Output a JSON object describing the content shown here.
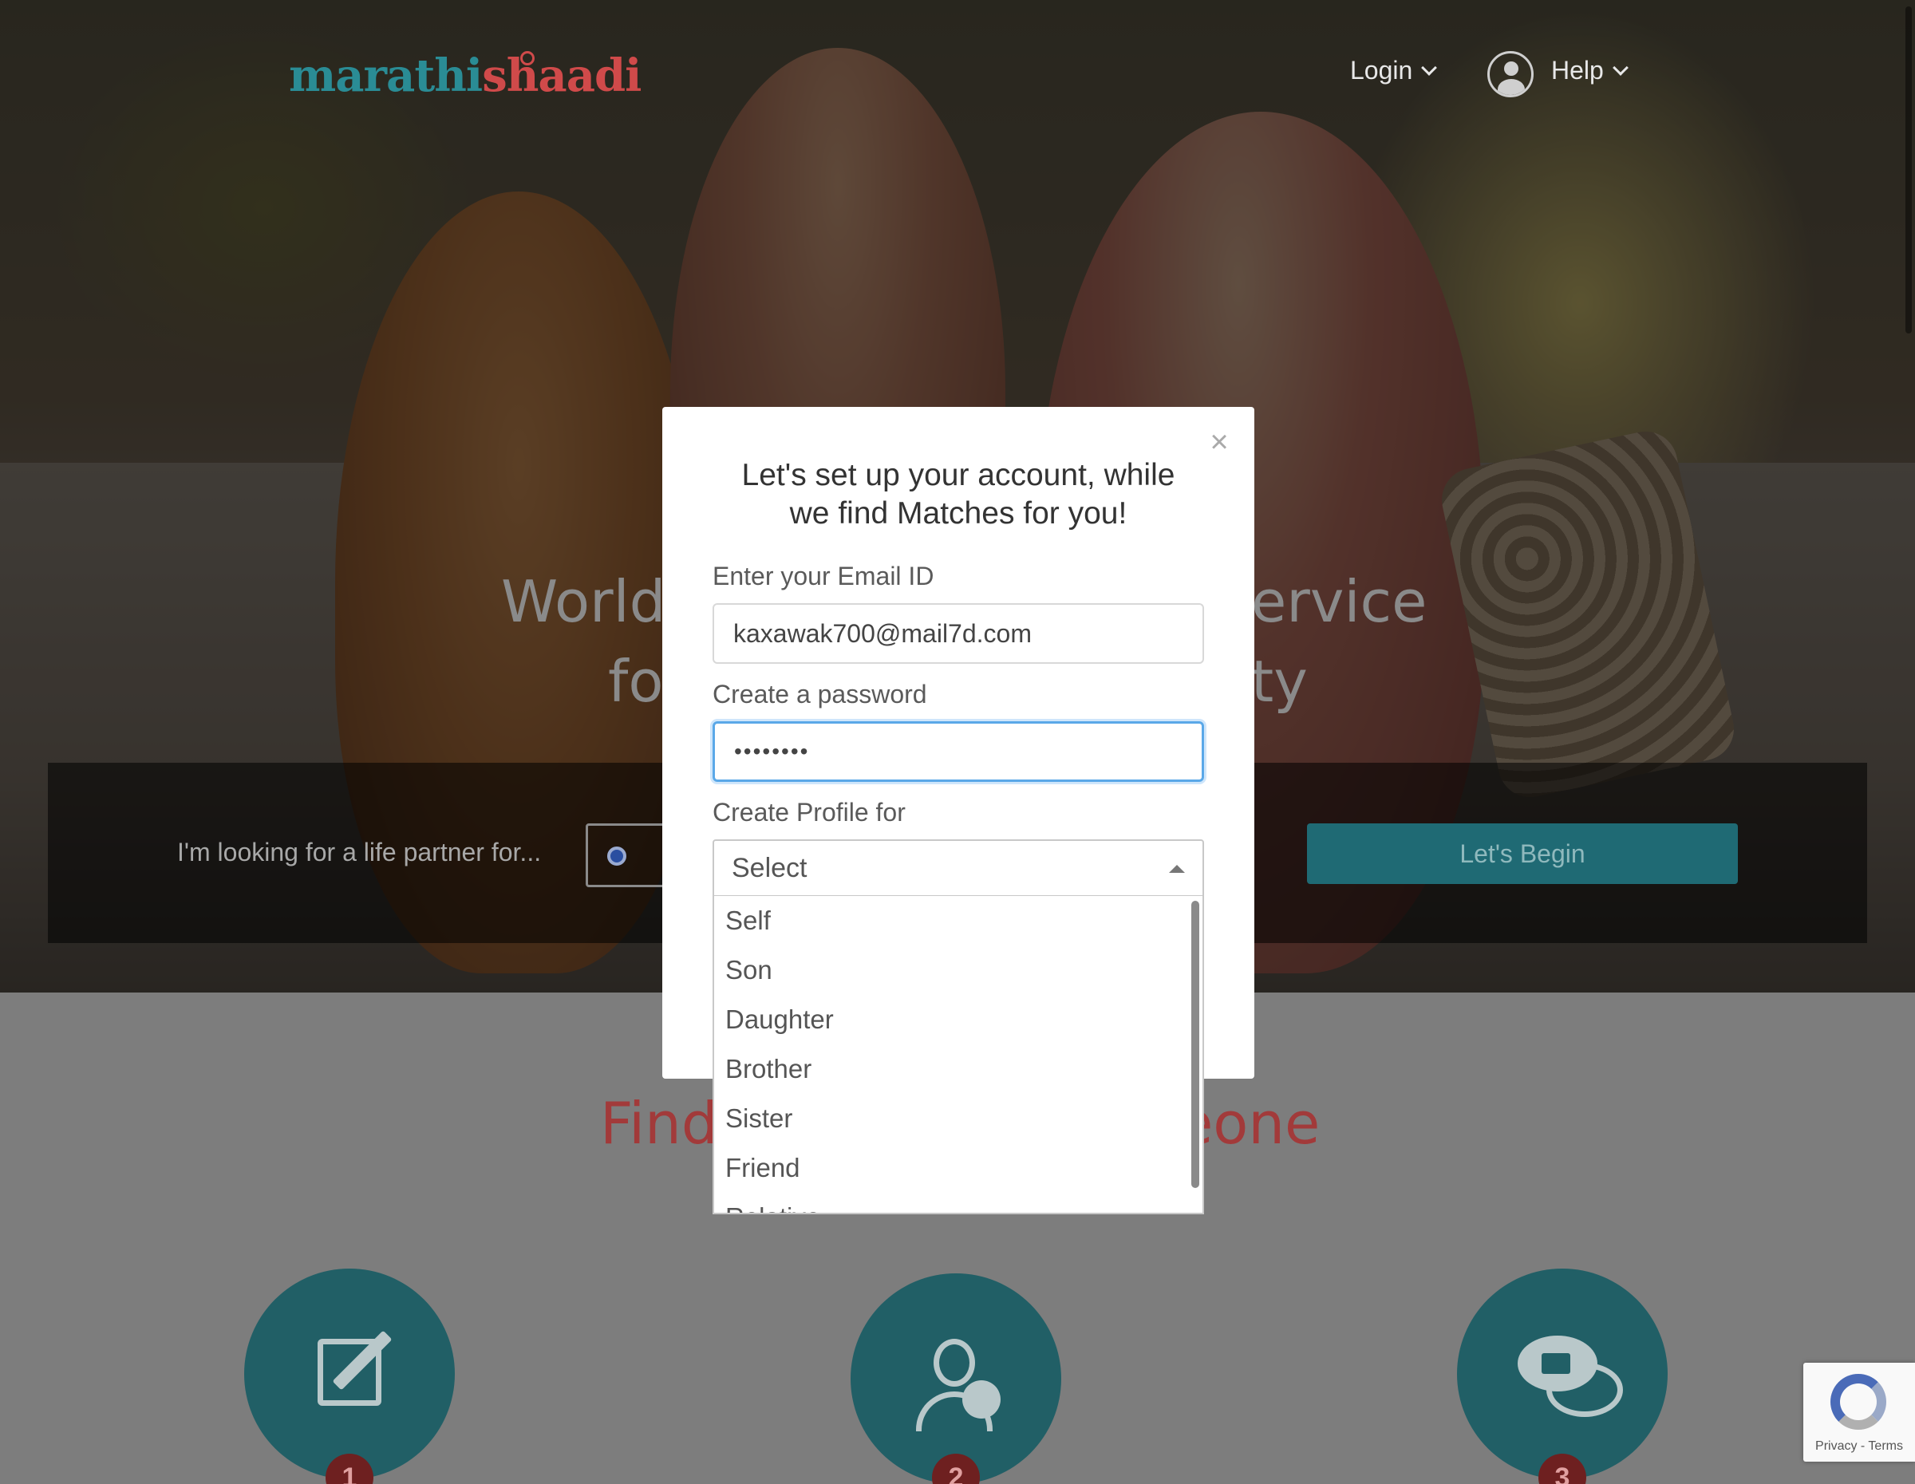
{
  "header": {
    "logo_part1": "marathi",
    "logo_part2": "shaadi",
    "login_label": "Login",
    "help_label": "Help"
  },
  "hero": {
    "headline_line1_left": "World",
    "headline_line1_right": "ervice",
    "headline_line2_left": "fo",
    "headline_line2_right": "ty",
    "search_label": "I'm looking for a life partner for...",
    "begin_button": "Let's Begin"
  },
  "section": {
    "title_left": "Find",
    "title_right": "eone",
    "steps": [
      "1",
      "2",
      "3"
    ]
  },
  "modal": {
    "title_line1": "Let's set up your account, while",
    "title_line2": "we find Matches for you!",
    "close_symbol": "×",
    "email_label": "Enter your Email ID",
    "email_value": "kaxawak700@mail7d.com",
    "password_label": "Create a password",
    "password_value": "••••••••",
    "profile_label": "Create Profile for",
    "profile_selected": "Select",
    "profile_options": [
      "Self",
      "Son",
      "Daughter",
      "Brother",
      "Sister",
      "Friend",
      "Relative"
    ]
  },
  "recaptcha": {
    "text": "Privacy - Terms"
  },
  "colors": {
    "teal": "#2a8c95",
    "brand_red": "#d04a4a",
    "focus_blue": "#5aa8e8"
  }
}
